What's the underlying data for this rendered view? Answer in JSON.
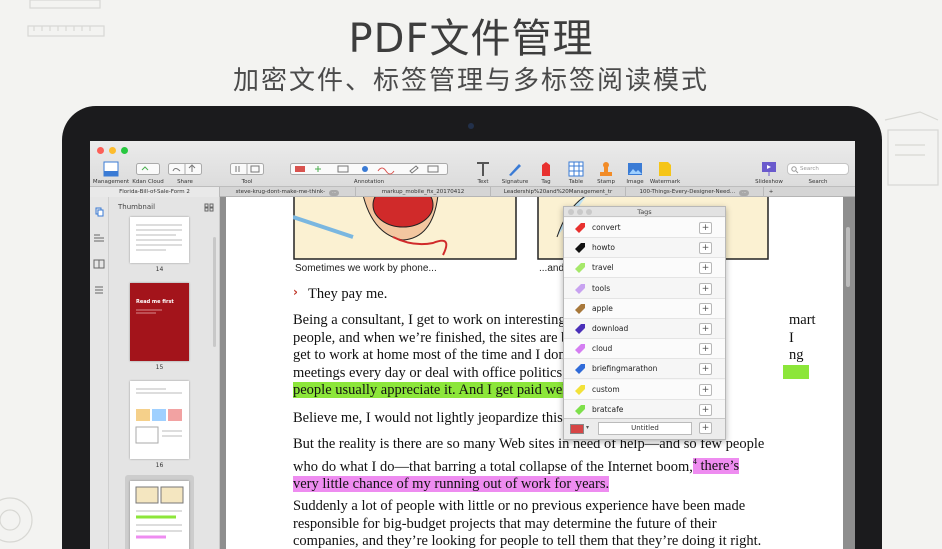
{
  "headline": "PDF文件管理",
  "subline": "加密文件、标签管理与多标签阅读模式",
  "toolbar": {
    "items": [
      {
        "label": "Management"
      },
      {
        "label": "Kdan Cloud"
      },
      {
        "label": "Share"
      },
      {
        "label": "Tool"
      },
      {
        "label": "Annotation"
      },
      {
        "label": "Text"
      },
      {
        "label": "Signature"
      },
      {
        "label": "Tag"
      },
      {
        "label": "Table"
      },
      {
        "label": "Stamp"
      },
      {
        "label": "Image"
      },
      {
        "label": "Watermark"
      },
      {
        "label": "Slideshow"
      },
      {
        "label": "Search"
      }
    ],
    "search_placeholder": "Search"
  },
  "tabs": [
    {
      "label": "Florida-Bill-of-Sale-Form 2"
    },
    {
      "label": "steve-krug-dont-make-me-think-",
      "close": "..."
    },
    {
      "label": "markup_mobile_fix_20170412"
    },
    {
      "label": "Leadership%20and%20Management_tr"
    },
    {
      "label": "100-Things-Every-Designer-Need...",
      "close": "..."
    },
    {
      "label": "+"
    }
  ],
  "thumbnails": {
    "title": "Thumbnail",
    "pages": [
      {
        "num": "14"
      },
      {
        "num": "15",
        "cover_text": "Read me first"
      },
      {
        "num": "16"
      },
      {
        "num": ""
      }
    ]
  },
  "document": {
    "caption_left": "Sometimes we work by phone...",
    "caption_right": "...and",
    "bullet": "They pay me.",
    "p1_a": "Being a consultant, I get to work on interesting",
    "p1_b": "mart",
    "p1_c": "people, and when we’re finished, the sites are b",
    "p1_d": "I",
    "p1_e": "get to work at home most of the time and I don’",
    "p1_f": "ng",
    "p1_g": "meetings every day or deal with office politics.",
    "p1_h": "people usually appreciate it. And I get paid wel",
    "p2": "Believe me, I would not lightly jeopardize this w",
    "p3_a": "But the reality is there are so many Web sites in need of help—and so few people",
    "p3_b": "who do what I do—that barring a total collapse of the Internet boom,",
    "p3_sup": "4",
    "p3_c": " there’s",
    "p3_d": "very little chance of my running out of work for years.",
    "p4_a": "Suddenly a lot of people with little or no previous experience have been made",
    "p4_b": "responsible for big-budget projects that may determine the future of their",
    "p4_c": "companies, and they’re looking for people to tell them that they’re doing it right."
  },
  "tags_panel": {
    "title": "Tags",
    "items": [
      {
        "label": "convert",
        "color": "#e8312f"
      },
      {
        "label": "howto",
        "color": "#111111"
      },
      {
        "label": "travel",
        "color": "#a6e86a"
      },
      {
        "label": "tools",
        "color": "#c8a2f0"
      },
      {
        "label": "apple",
        "color": "#a8783a"
      },
      {
        "label": "download",
        "color": "#4a2fb8"
      },
      {
        "label": "cloud",
        "color": "#d47ef2"
      },
      {
        "label": "briefingmarathon",
        "color": "#2f6ad8"
      },
      {
        "label": "custom",
        "color": "#f2e23a"
      },
      {
        "label": "bratcafe",
        "color": "#7ee04a"
      }
    ],
    "add_symbol": "+",
    "new_tag_value": "Untitled",
    "new_tag_color": "#d64545"
  }
}
